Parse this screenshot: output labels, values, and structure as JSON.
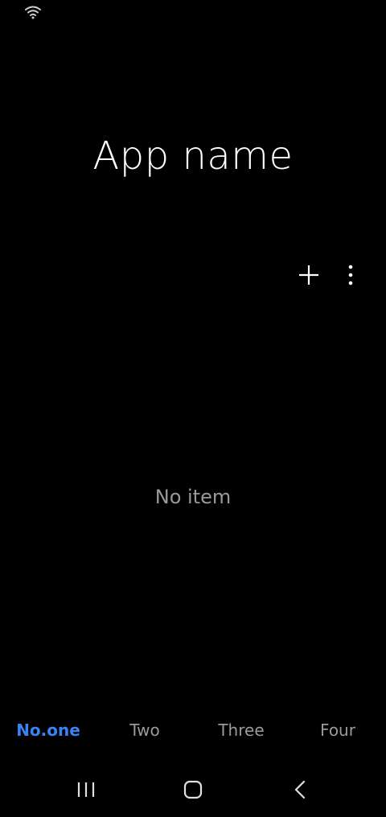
{
  "app": {
    "title": "App name"
  },
  "main": {
    "empty_text": "No item"
  },
  "toolbar": {
    "add_icon": "plus-icon",
    "more_icon": "more-vertical-icon"
  },
  "tabs": [
    {
      "label": "No.one",
      "active": true
    },
    {
      "label": "Two",
      "active": false
    },
    {
      "label": "Three",
      "active": false
    },
    {
      "label": "Four",
      "active": false
    }
  ],
  "nav": {
    "recents_icon": "recents-icon",
    "home_icon": "home-icon",
    "back_icon": "back-icon"
  },
  "colors": {
    "background": "#000000",
    "accent": "#3b82f6",
    "muted_text": "#9a9a9a"
  }
}
